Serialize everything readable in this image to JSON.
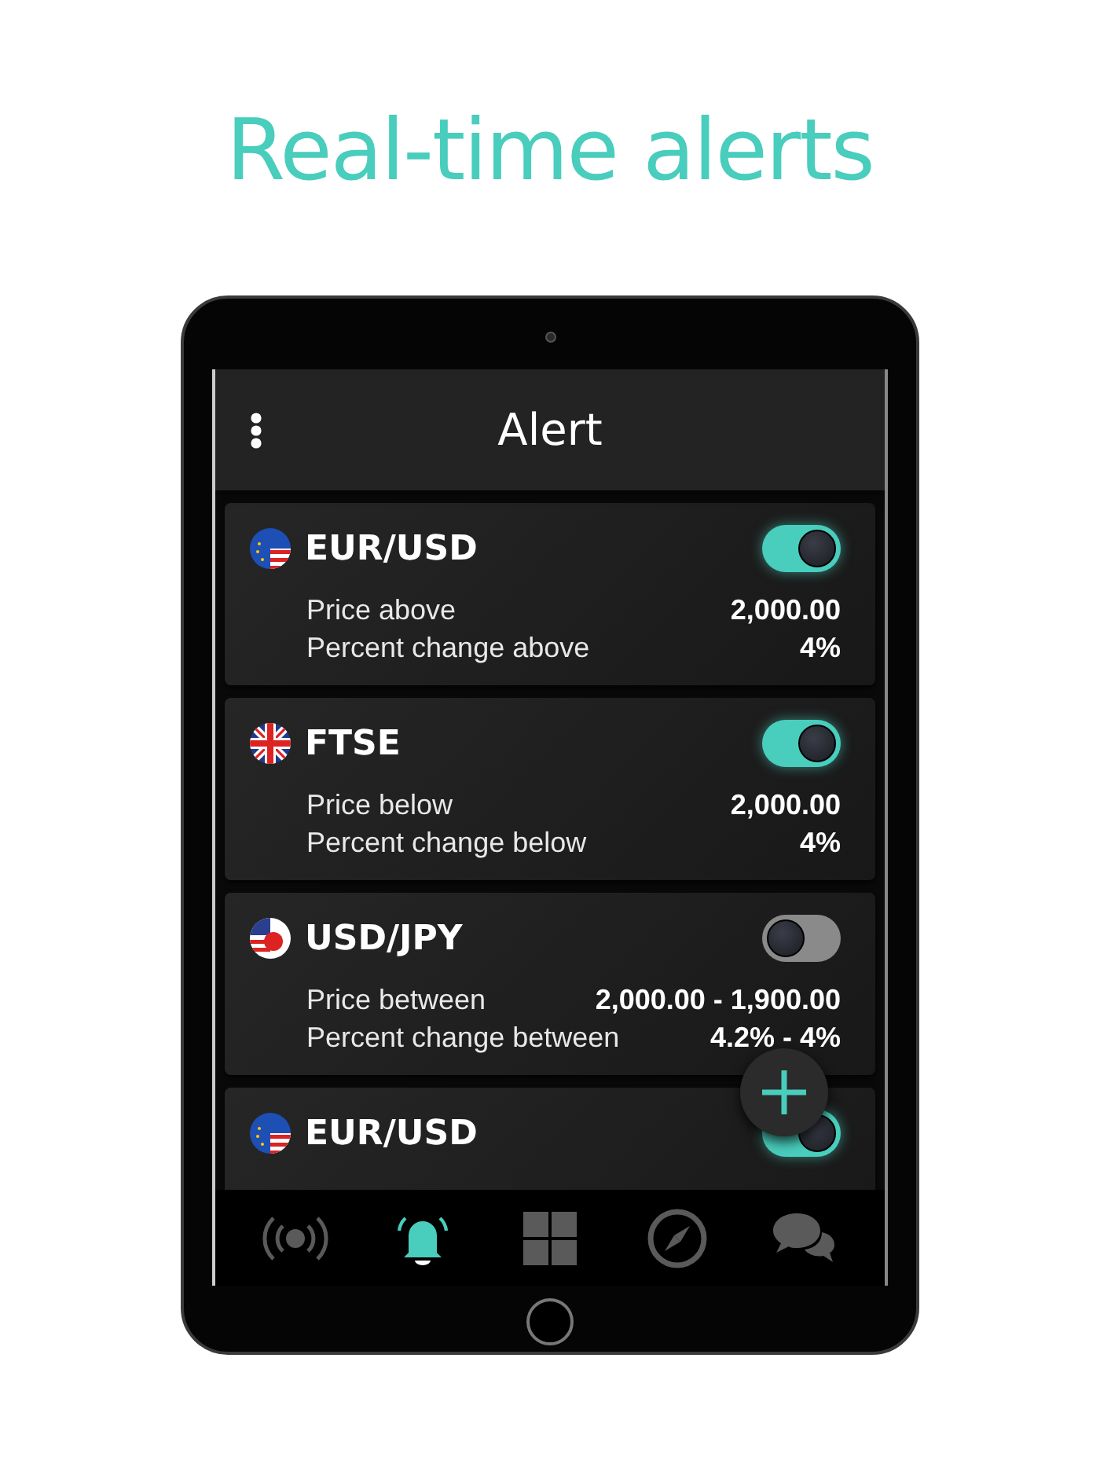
{
  "headline": "Real-time alerts",
  "app_bar": {
    "title": "Alert"
  },
  "alerts": [
    {
      "pair": "EUR/USD",
      "flag": {
        "kind": "eu-us"
      },
      "enabled": true,
      "conditions": [
        {
          "label": "Price above",
          "value": "2,000.00"
        },
        {
          "label": "Percent change above",
          "value": "4%"
        }
      ]
    },
    {
      "pair": "FTSE",
      "flag": {
        "kind": "uk"
      },
      "enabled": true,
      "conditions": [
        {
          "label": "Price below",
          "value": "2,000.00"
        },
        {
          "label": "Percent change below",
          "value": "4%"
        }
      ]
    },
    {
      "pair": "USD/JPY",
      "flag": {
        "kind": "us-jp"
      },
      "enabled": false,
      "conditions": [
        {
          "label": "Price between",
          "value": "2,000.00 - 1,900.00"
        },
        {
          "label": "Percent change between",
          "value": "4.2% - 4%"
        }
      ]
    },
    {
      "pair": "EUR/USD",
      "flag": {
        "kind": "eu-us"
      },
      "enabled": true
    }
  ],
  "fab": {
    "kind": "add"
  },
  "nav": [
    {
      "kind": "broadcast",
      "selected": false
    },
    {
      "kind": "bell",
      "selected": true
    },
    {
      "kind": "grid",
      "selected": false
    },
    {
      "kind": "compass",
      "selected": false
    },
    {
      "kind": "chat",
      "selected": false
    }
  ]
}
